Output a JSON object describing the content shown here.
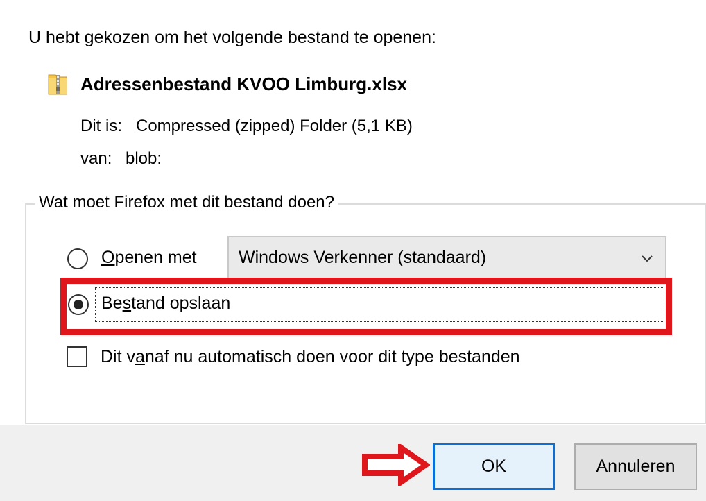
{
  "dialog": {
    "intro": "U hebt gekozen om het volgende bestand te openen:",
    "file_name": "Adressenbestand KVOO Limburg.xlsx",
    "type_label": "Dit is:",
    "type_value": "Compressed (zipped) Folder (5,1 KB)",
    "from_label": "van:",
    "from_value": "blob:"
  },
  "group": {
    "legend": "Wat moet Firefox met dit bestand doen?",
    "open_with": {
      "prefix": "",
      "accel": "O",
      "rest": "penen met",
      "selected": false
    },
    "app_select": {
      "value": "Windows Verkenner (standaard)"
    },
    "save_file": {
      "prefix": "Be",
      "accel": "s",
      "rest": "tand opslaan",
      "selected": true
    },
    "auto_checkbox": {
      "prefix": "Dit v",
      "accel": "a",
      "rest": "naf nu automatisch doen voor dit type bestanden",
      "checked": false
    }
  },
  "buttons": {
    "ok": "OK",
    "cancel": "Annuleren"
  },
  "colors": {
    "highlight_red": "#e0161d",
    "focus_blue": "#0a6fd6"
  }
}
